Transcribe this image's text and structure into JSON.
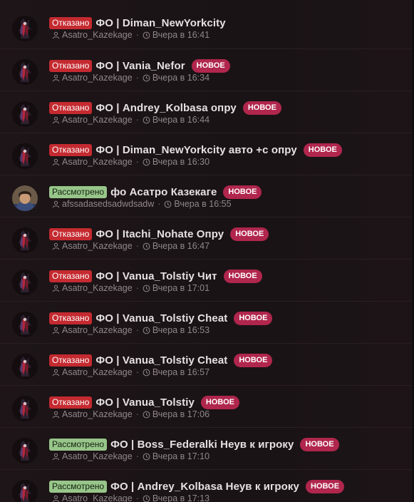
{
  "threads": [
    {
      "prefix": "Отказано",
      "prefix_color": "#c42a30",
      "prefix_type": "red",
      "title": "ФО | Diman_NewYorkcity",
      "badge": "",
      "author": "Asatro_Kazekage",
      "date": "Вчера в 16:41",
      "avatar": "dark-avatar"
    },
    {
      "prefix": "Отказано",
      "prefix_color": "#c42a30",
      "prefix_type": "red",
      "title": "ФО | Vania_Nefor",
      "badge": "НОВОЕ",
      "author": "Asatro_Kazekage",
      "date": "Вчера в 16:34",
      "avatar": "dark-avatar"
    },
    {
      "prefix": "Отказано",
      "prefix_color": "#c42a30",
      "prefix_type": "red",
      "title": "ФО | Andrey_Kolbasa опру",
      "badge": "НОВОЕ",
      "author": "Asatro_Kazekage",
      "date": "Вчера в 16:44",
      "avatar": "dark-avatar"
    },
    {
      "prefix": "Отказано",
      "prefix_color": "#c42a30",
      "prefix_type": "red",
      "title": "ФО | Diman_NewYorkcity авто +с опру",
      "badge": "НОВОЕ",
      "author": "Asatro_Kazekage",
      "date": "Вчера в 16:30",
      "avatar": "dark-avatar"
    },
    {
      "prefix": "Рассмотрено",
      "prefix_color": "#98c68a",
      "prefix_type": "green",
      "title": "фо Асатро Казекаге",
      "badge": "НОВОЕ",
      "author": "afssadasedsadwdsadw",
      "date": "Вчера в 16:55",
      "avatar": "photo-avatar"
    },
    {
      "prefix": "Отказано",
      "prefix_color": "#c42a30",
      "prefix_type": "red",
      "title": "ФО | Itachi_Nohate Опру",
      "badge": "НОВОЕ",
      "author": "Asatro_Kazekage",
      "date": "Вчера в 16:47",
      "avatar": "dark-avatar"
    },
    {
      "prefix": "Отказано",
      "prefix_color": "#c42a30",
      "prefix_type": "red",
      "title": "ФО | Vanua_Tolstiy Чит",
      "badge": "НОВОЕ",
      "author": "Asatro_Kazekage",
      "date": "Вчера в 17:01",
      "avatar": "dark-avatar"
    },
    {
      "prefix": "Отказано",
      "prefix_color": "#c42a30",
      "prefix_type": "red",
      "title": "ФО | Vanua_Tolstiy Cheat",
      "badge": "НОВОЕ",
      "author": "Asatro_Kazekage",
      "date": "Вчера в 16:53",
      "avatar": "dark-avatar"
    },
    {
      "prefix": "Отказано",
      "prefix_color": "#c42a30",
      "prefix_type": "red",
      "title": "ФО | Vanua_Tolstiy Cheat",
      "badge": "НОВОЕ",
      "author": "Asatro_Kazekage",
      "date": "Вчера в 16:57",
      "avatar": "dark-avatar"
    },
    {
      "prefix": "Отказано",
      "prefix_color": "#c42a30",
      "prefix_type": "red",
      "title": "ФО | Vanua_Tolstiy",
      "badge": "НОВОЕ",
      "author": "Asatro_Kazekage",
      "date": "Вчера в 17:06",
      "avatar": "dark-avatar"
    },
    {
      "prefix": "Рассмотрено",
      "prefix_color": "#98c68a",
      "prefix_type": "green",
      "title": "ФО | Boss_Federalki Неув к игроку",
      "badge": "НОВОЕ",
      "author": "Asatro_Kazekage",
      "date": "Вчера в 17:10",
      "avatar": "dark-avatar"
    },
    {
      "prefix": "Рассмотрено",
      "prefix_color": "#98c68a",
      "prefix_type": "green",
      "title": "ФО | Andrey_Kolbasa Неув к игроку",
      "badge": "НОВОЕ",
      "author": "Asatro_Kazekage",
      "date": "Вчера в 17:13",
      "avatar": "dark-avatar"
    }
  ],
  "icons": {
    "author": "user-icon",
    "date": "clock-icon"
  },
  "colors": {
    "badge": "#b0264d",
    "background": "#1b1416",
    "meta_text": "#8f8789"
  }
}
